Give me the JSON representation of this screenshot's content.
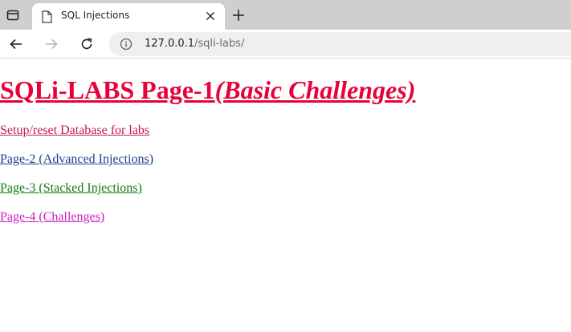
{
  "browser": {
    "tab": {
      "title": "SQL Injections"
    },
    "address": {
      "host": "127.0.0.1",
      "path": "/sqli-labs/"
    }
  },
  "page": {
    "heading": {
      "main": "SQLi-LABS Page-1",
      "sub": "(Basic Challenges)"
    },
    "links": [
      {
        "label": "Setup/reset Database for labs",
        "color": "#c2185b"
      },
      {
        "label": "Page-2 (Advanced Injections)",
        "color": "#1d3f8a"
      },
      {
        "label": "Page-3 (Stacked Injections)",
        "color": "#137a13"
      },
      {
        "label": "Page-4 (Challenges)",
        "color": "#cc1fbf"
      }
    ],
    "heading_color": "#e8003a"
  },
  "icons": [
    "tab-actions-icon",
    "page-icon",
    "close-icon",
    "plus-icon",
    "back-arrow-icon",
    "forward-arrow-icon",
    "reload-icon",
    "info-icon"
  ]
}
